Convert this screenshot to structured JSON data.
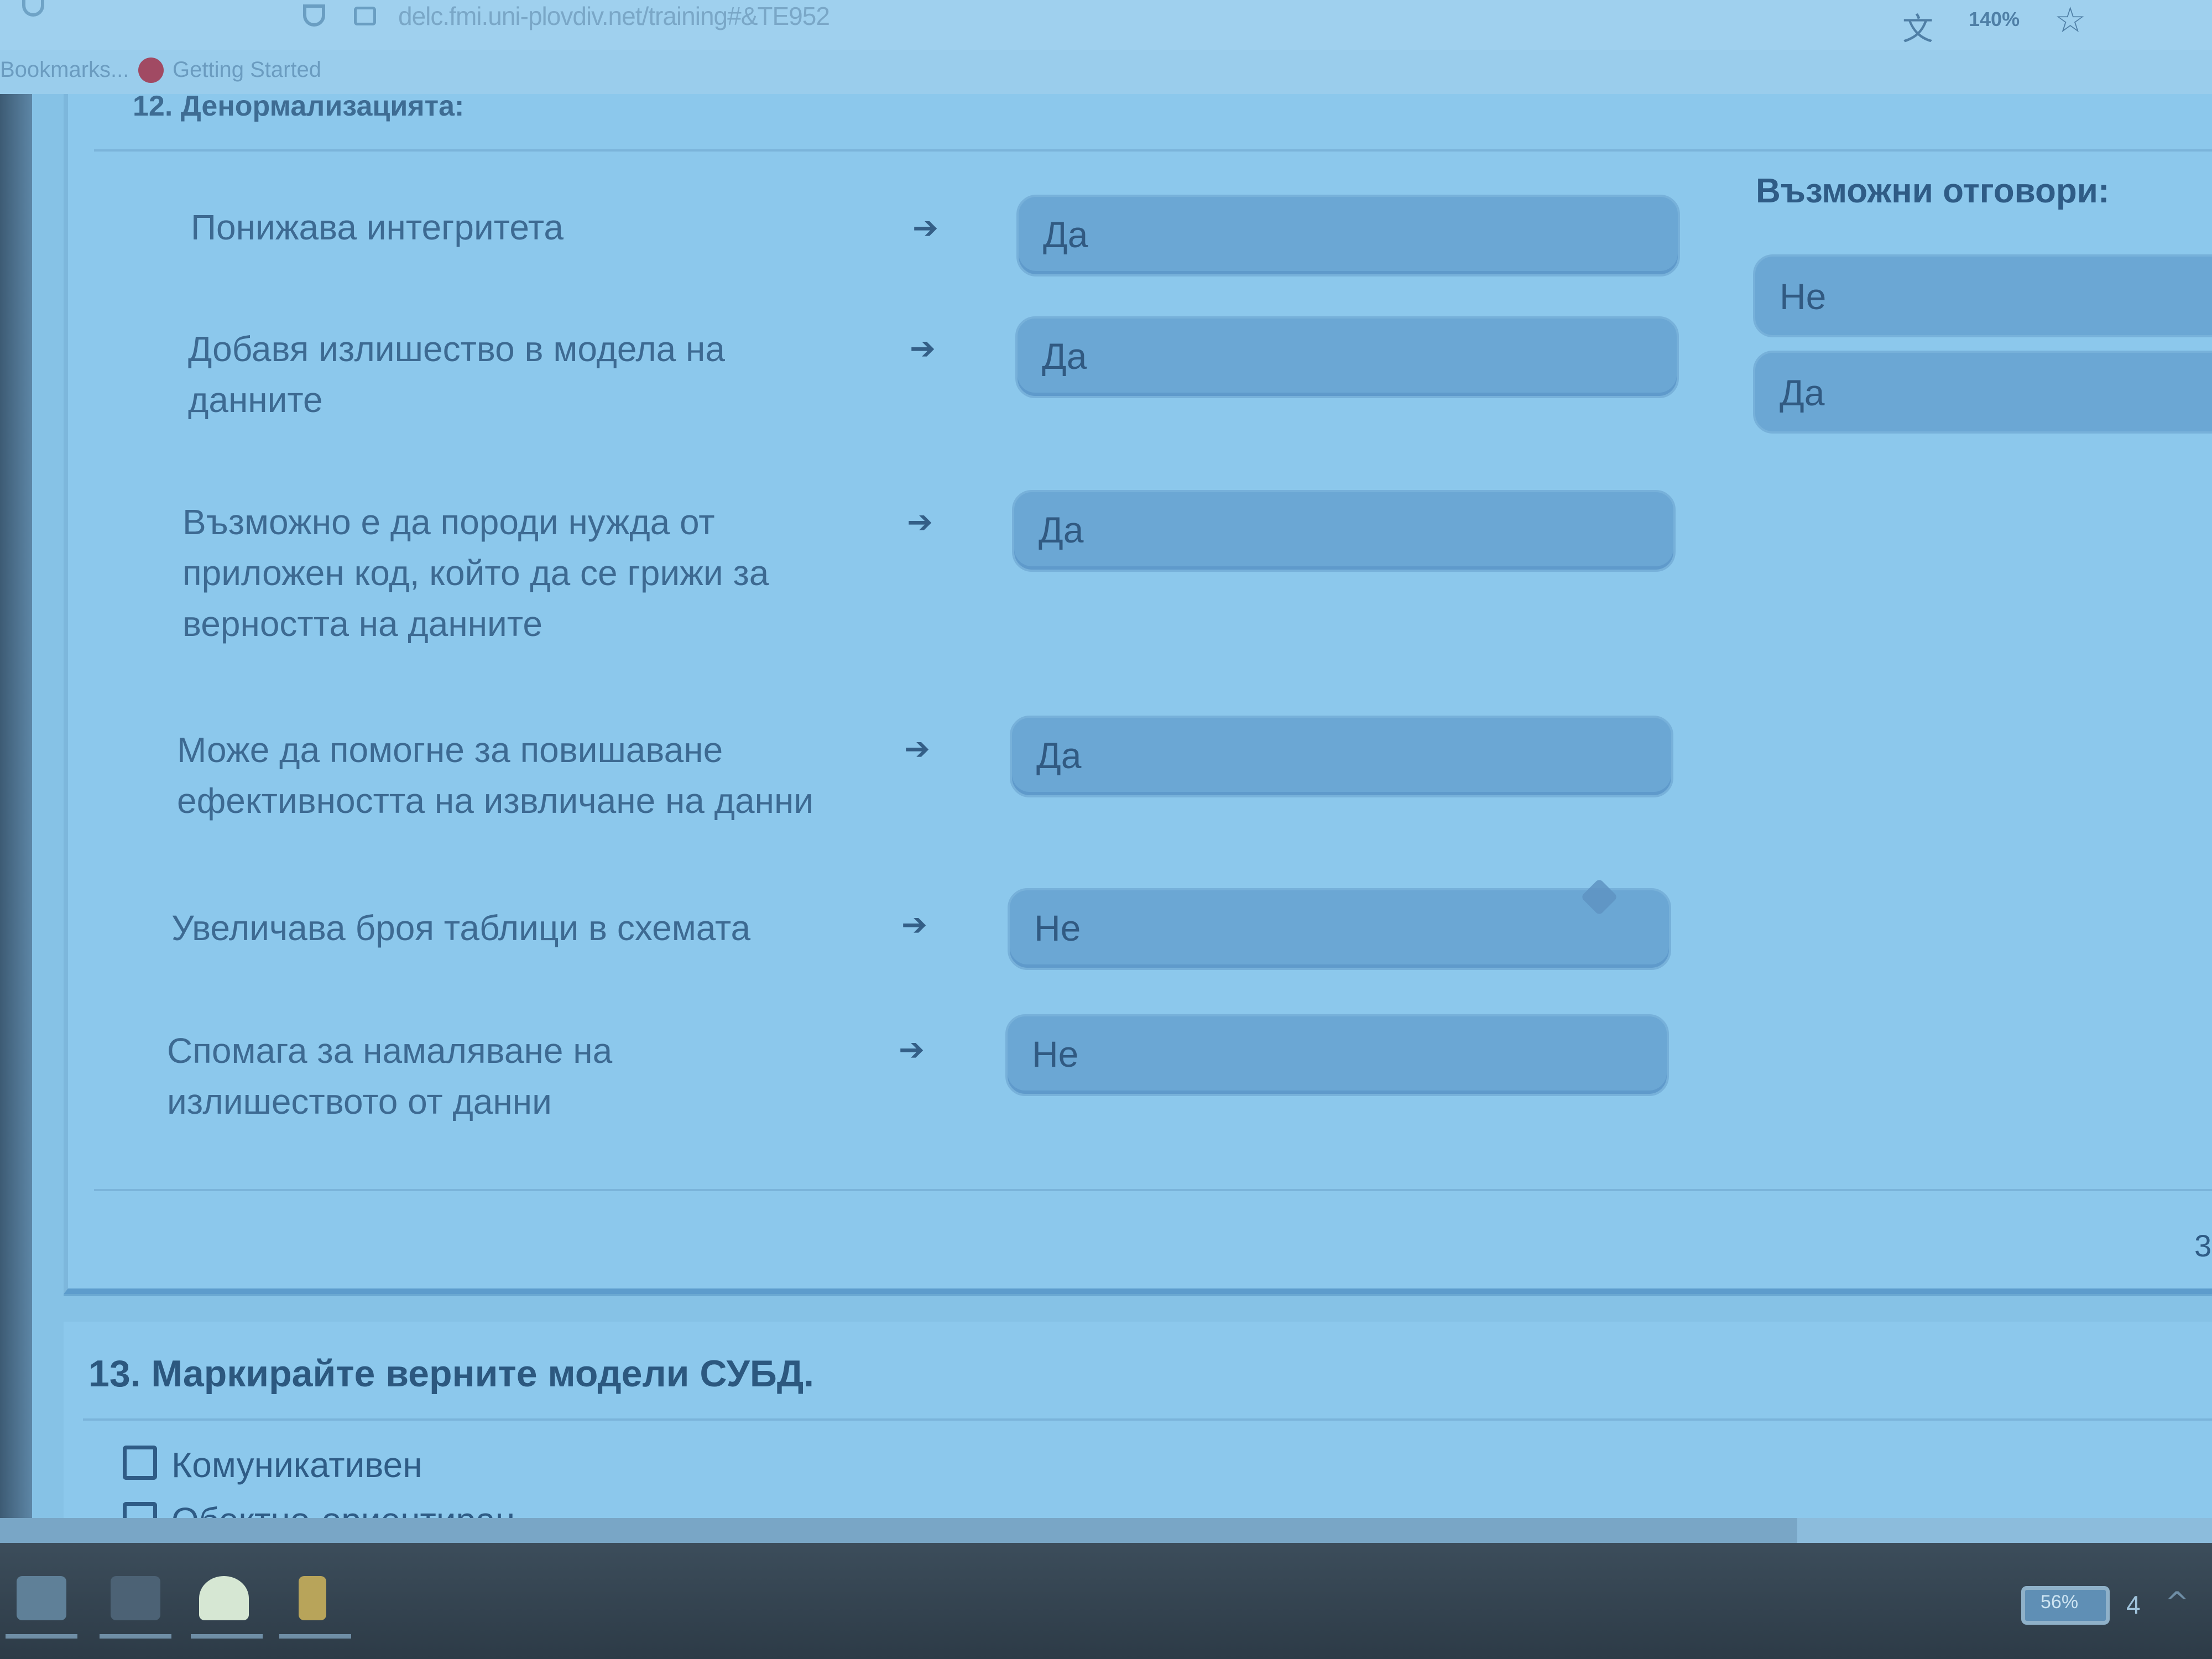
{
  "browser": {
    "url": "delc.fmi.uni-plovdiv.net/training#&TE952",
    "zoom": "140%",
    "bookmarks": [
      "Bookmarks...",
      "Getting Started"
    ]
  },
  "question12": {
    "heading_partial": "12. Денормализацията:",
    "pairs": [
      {
        "prompt_lines": [
          "Понижава интегритета"
        ],
        "answer": "Да"
      },
      {
        "prompt_lines": [
          "Добавя излишество в модела на",
          "данните"
        ],
        "answer": "Да"
      },
      {
        "prompt_lines": [
          "Възможно е да породи нужда от",
          "приложен код, който да се грижи за",
          "верността на данните"
        ],
        "answer": "Да"
      },
      {
        "prompt_lines": [
          "Може да помогне за повишаване",
          "ефективността на извличане на данни"
        ],
        "answer": "Да"
      },
      {
        "prompt_lines": [
          "Увеличава броя таблици в схемата"
        ],
        "answer": "Не"
      },
      {
        "prompt_lines": [
          "Спомага за намаляване на",
          "излишеството от данни"
        ],
        "answer": "Не"
      }
    ],
    "options_title": "Възможни отговори:",
    "options": [
      "Не",
      "Да"
    ],
    "arrow_glyph": "➔"
  },
  "page_number_partial": "3",
  "question13": {
    "title": "13. Маркирайте верните модели СУБД.",
    "choices": [
      "Комуникативен",
      "Обектно-ориентиран"
    ]
  },
  "taskbar": {
    "battery": "56%",
    "tray_text": "4"
  },
  "icons": [
    "back-icon",
    "shield-icon",
    "lock-icon",
    "translate-icon",
    "star-icon",
    "drag-handle-icon"
  ],
  "colors": {
    "page_bg": "#86c2e6",
    "answer_box": "#6ba7d4",
    "text": "#2f5c86",
    "taskbar": "#2d3b47"
  }
}
